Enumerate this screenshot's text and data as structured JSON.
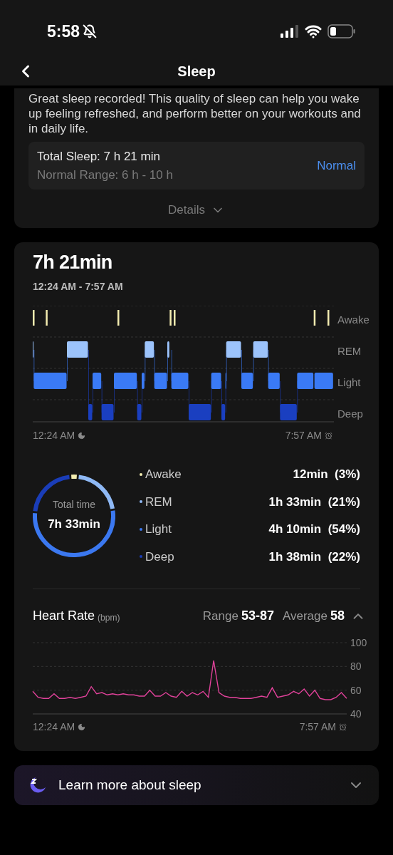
{
  "status_bar": {
    "time": "5:58"
  },
  "nav": {
    "title": "Sleep"
  },
  "summary": {
    "message": "Great sleep recorded! This quality of sleep can help you wake up feeling refreshed, and perform better on your workouts and in daily life.",
    "total": "Total Sleep: 7 h 21 min",
    "range": "Normal Range: 6 h - 10 h",
    "status": "Normal",
    "details": "Details"
  },
  "stages": {
    "duration": "7h 21min",
    "period": "12:24 AM - 7:57 AM",
    "stage_labels": [
      "Awake",
      "REM",
      "Light",
      "Deep"
    ],
    "start": "12:24 AM",
    "end": "7:57 AM",
    "total_label": "Total time",
    "total_value": "7h 33min",
    "legend": [
      {
        "name": "Awake",
        "value": "12min  (3%)",
        "color": "#f3ecb0"
      },
      {
        "name": "REM",
        "value": "1h 33min  (21%)",
        "color": "#8fb9f5"
      },
      {
        "name": "Light",
        "value": "4h 10min  (54%)",
        "color": "#3b78f0"
      },
      {
        "name": "Deep",
        "value": "1h 38min  (22%)",
        "color": "#1a3db8"
      }
    ]
  },
  "heart_rate": {
    "title": "Heart Rate",
    "unit": "(bpm)",
    "range_label": "Range",
    "range": "53-87",
    "average_label": "Average",
    "average": "58",
    "expanded": true,
    "start": "12:24 AM",
    "end": "7:57 AM",
    "chart_data": {
      "type": "line",
      "ylim": [
        40,
        100
      ],
      "yticks": [
        40,
        60,
        80,
        100
      ],
      "series": [
        {
          "color": "#e0429a",
          "values": [
            59,
            54,
            53,
            53,
            57,
            53,
            53,
            54,
            53,
            54,
            55,
            63,
            57,
            58,
            56,
            57,
            56,
            57,
            56,
            56,
            55,
            55,
            60,
            55,
            55,
            58,
            55,
            54,
            59,
            55,
            58,
            56,
            59,
            54,
            85,
            58,
            55,
            54,
            54,
            53,
            53,
            53,
            54,
            55,
            54,
            62,
            54,
            55,
            56,
            59,
            57,
            61,
            55,
            60,
            53,
            52,
            52,
            54,
            58,
            53
          ]
        }
      ]
    }
  },
  "learn_more": {
    "label": "Learn more about sleep",
    "expanded": false
  }
}
